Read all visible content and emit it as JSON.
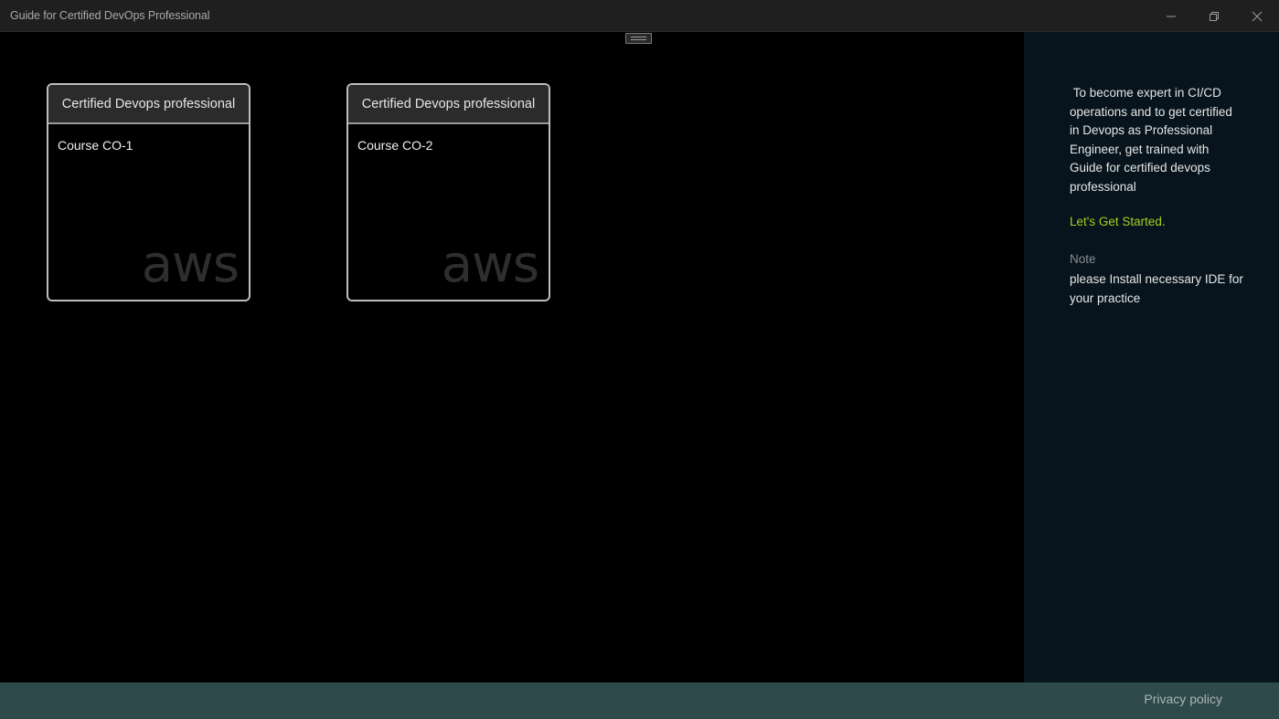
{
  "window": {
    "title": "Guide for Certified DevOps Professional",
    "controls": {
      "minimize_icon": "minimize-icon",
      "maximize_icon": "restore-icon",
      "close_icon": "close-icon"
    }
  },
  "cards": [
    {
      "header": "Certified Devops professional",
      "course": "Course CO-1",
      "watermark": "aws"
    },
    {
      "header": "Certified Devops professional",
      "course": "Course CO-2",
      "watermark": "aws"
    }
  ],
  "sidepanel": {
    "description": " To become expert in CI/CD operations and to get certified in Devops as Professional Engineer, get trained with Guide for certified devops professional",
    "cta": "Let's Get Started.",
    "note_title": "Note",
    "note_text": "please Install necessary IDE for your practice"
  },
  "footer": {
    "privacy_label": "Privacy policy"
  },
  "colors": {
    "titlebar_bg": "#1f1f1f",
    "content_bg": "#000000",
    "sidepanel_bg": "#07141d",
    "footer_bg": "#2f4a4a",
    "accent_green": "#a6cf1f"
  }
}
